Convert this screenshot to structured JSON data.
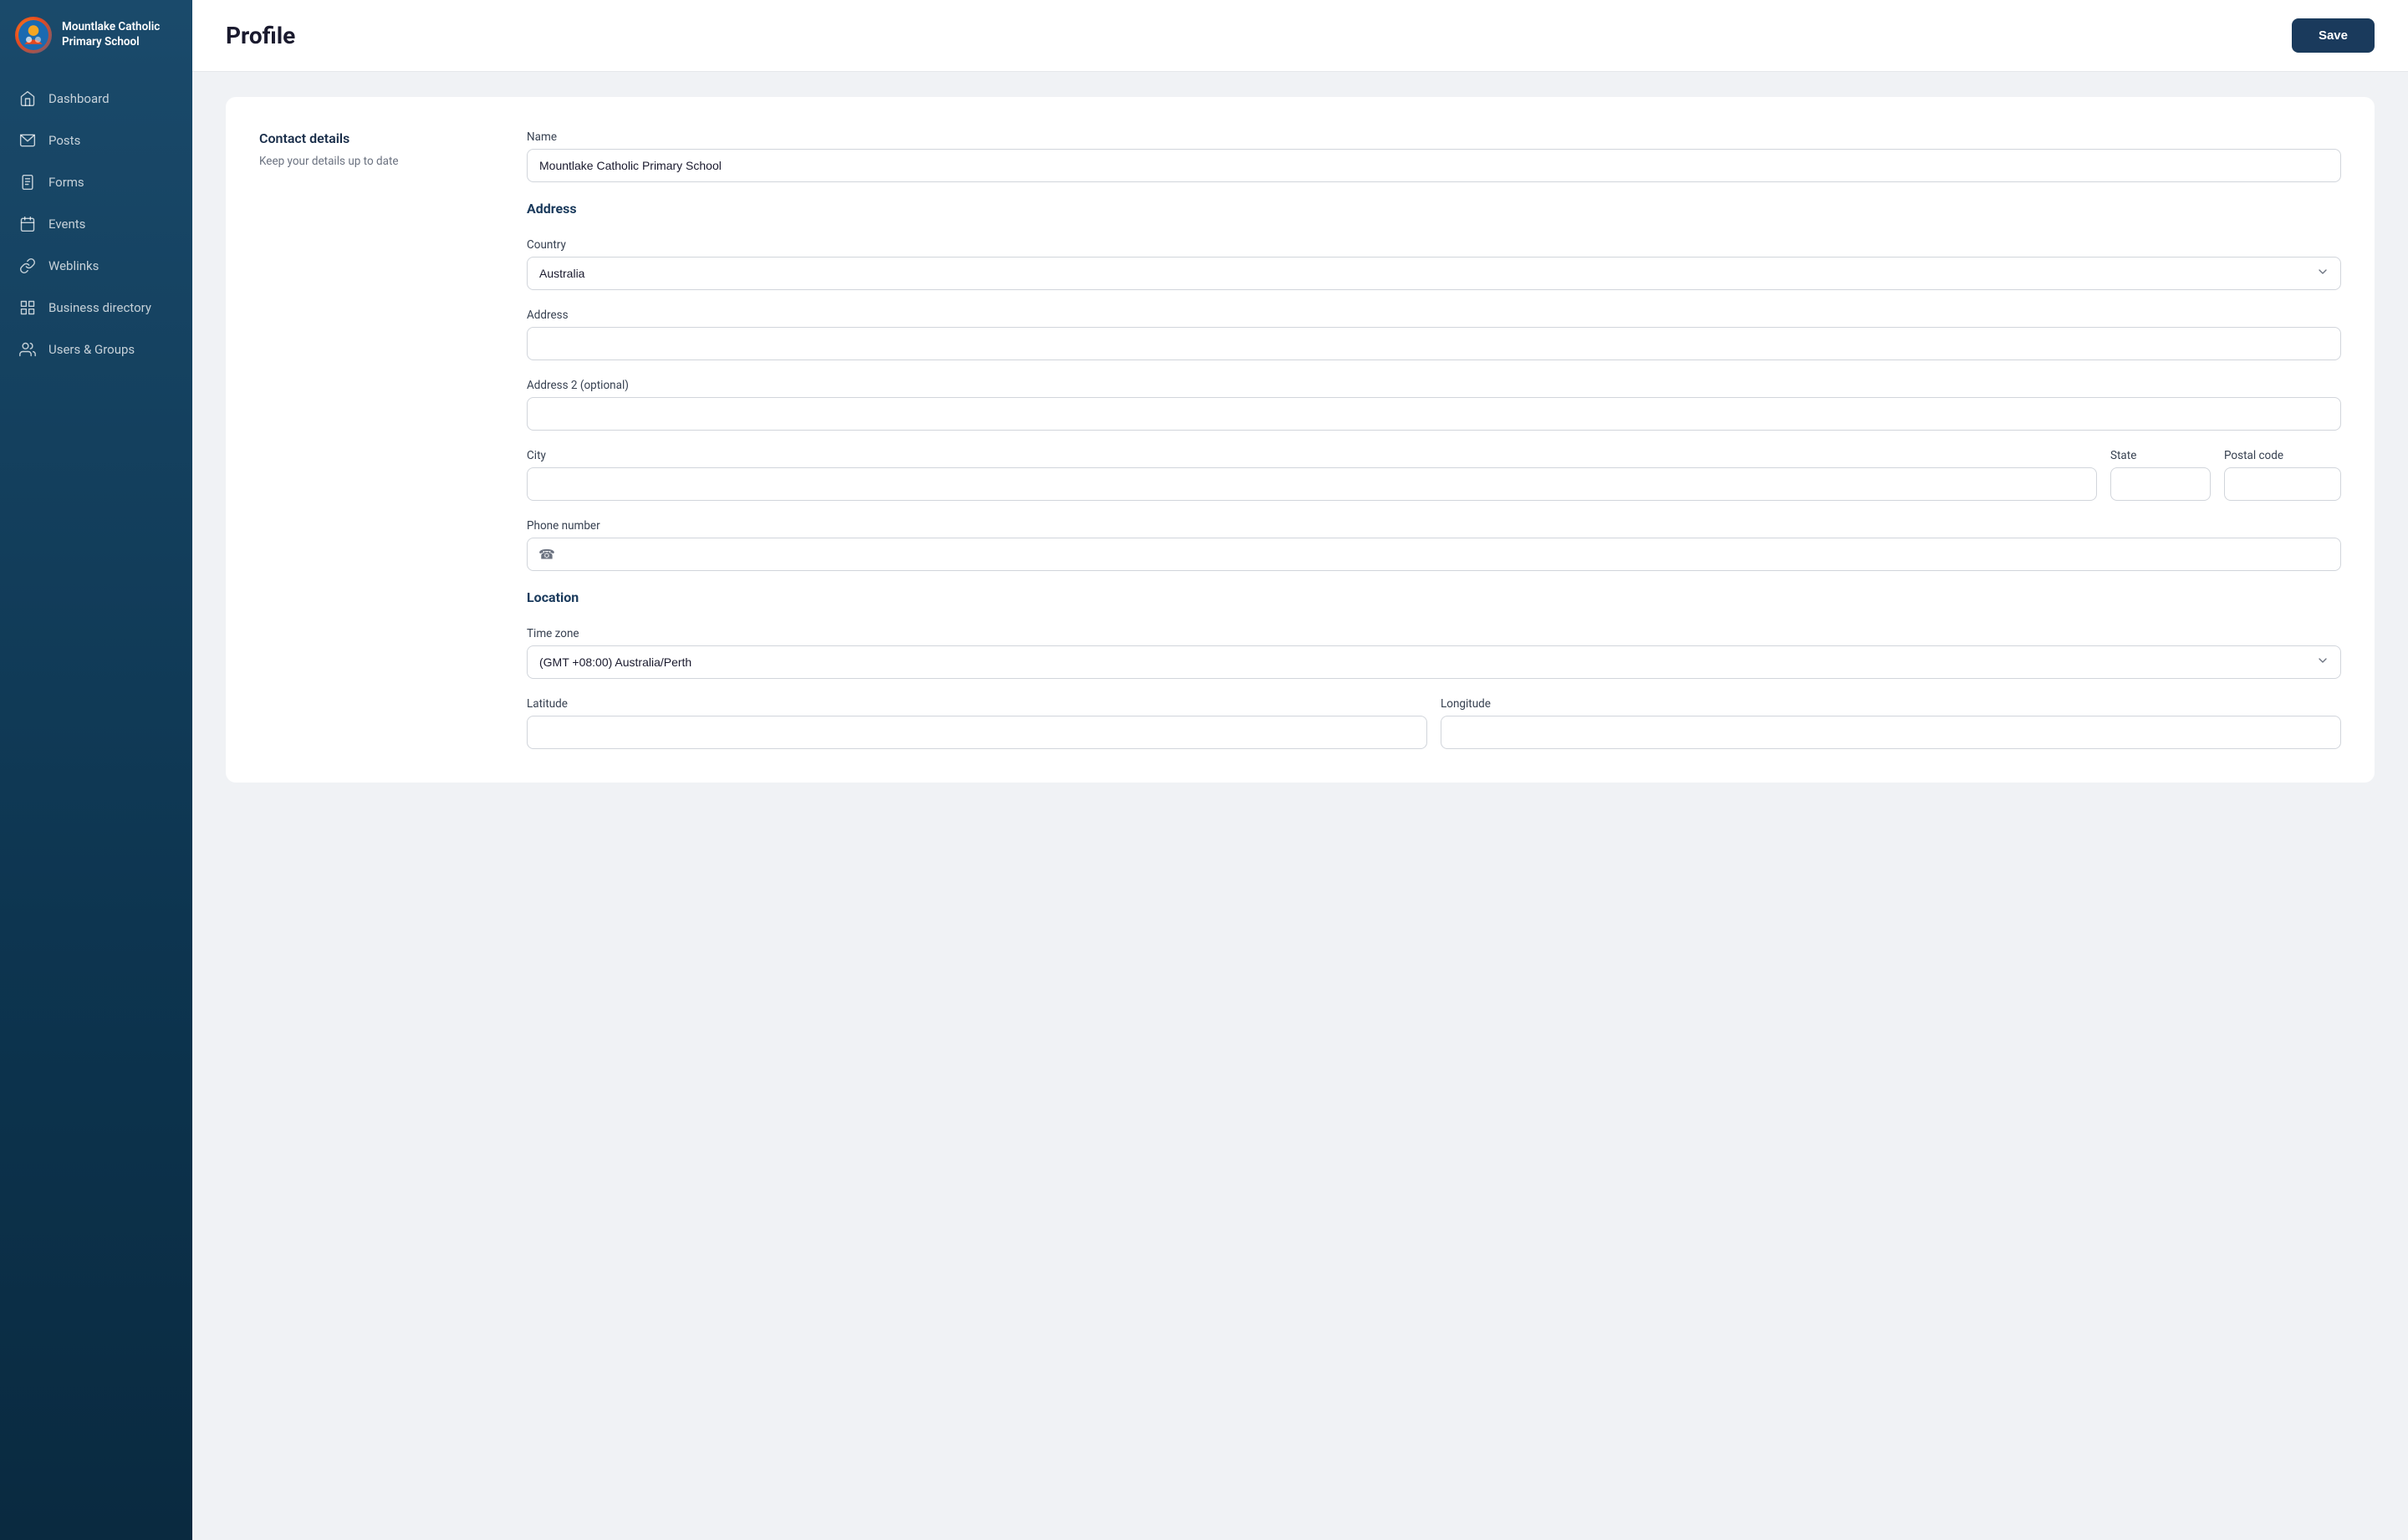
{
  "app": {
    "name": "Mountlake Catholic Primary School"
  },
  "header": {
    "title": "Profile",
    "save_label": "Save"
  },
  "sidebar": {
    "logo_text_line1": "Mountlake Catholic",
    "logo_text_line2": "Primary School",
    "items": [
      {
        "id": "dashboard",
        "label": "Dashboard",
        "icon": "home"
      },
      {
        "id": "posts",
        "label": "Posts",
        "icon": "mail"
      },
      {
        "id": "forms",
        "label": "Forms",
        "icon": "clipboard"
      },
      {
        "id": "events",
        "label": "Events",
        "icon": "calendar"
      },
      {
        "id": "weblinks",
        "label": "Weblinks",
        "icon": "link"
      },
      {
        "id": "business-directory",
        "label": "Business directory",
        "icon": "grid"
      },
      {
        "id": "users-groups",
        "label": "Users & Groups",
        "icon": "users"
      }
    ]
  },
  "form": {
    "contact_details": {
      "title": "Contact details",
      "description": "Keep your details up to date"
    },
    "fields": {
      "name_label": "Name",
      "name_value": "Mountlake Catholic Primary School",
      "address_section": "Address",
      "country_label": "Country",
      "country_value": "Australia",
      "address_label": "Address",
      "address_value": "",
      "address2_label": "Address 2 (optional)",
      "address2_value": "",
      "city_label": "City",
      "city_value": "",
      "state_label": "State",
      "state_value": "",
      "postal_label": "Postal code",
      "postal_value": "",
      "phone_label": "Phone number",
      "phone_value": "",
      "location_section": "Location",
      "timezone_label": "Time zone",
      "timezone_value": "(GMT +08:00) Australia/Perth",
      "latitude_label": "Latitude",
      "latitude_value": "",
      "longitude_label": "Longitude",
      "longitude_value": ""
    }
  }
}
